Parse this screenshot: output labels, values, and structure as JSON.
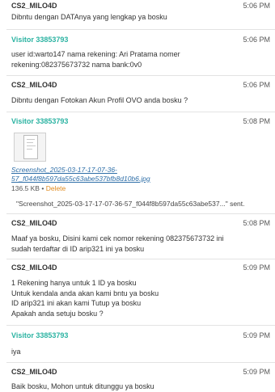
{
  "messages": [
    {
      "sender": "CS2_MILO4D",
      "time": "5:06 PM",
      "lines": [
        "Dibntu dengan DATAnya yang lengkap ya bosku"
      ]
    },
    {
      "sender": "Visitor 33853793",
      "time": "5:06 PM",
      "lines": [
        "user id:warto147 nama rekening: Ari Pratama nomer",
        "rekening:082375673732 nama bank:0v0"
      ]
    },
    {
      "sender": "CS2_MILO4D",
      "time": "5:06 PM",
      "lines": [
        "Dibntu dengan Fotokan Akun Profil OVO anda bosku ?"
      ]
    },
    {
      "sender": "Visitor 33853793",
      "time": "5:08 PM",
      "attachment": {
        "name_line1": "Screenshot_2025-03-17-17-07-36-",
        "name_line2": "57_f044f8b597da55c63abe537bfb8d10b6.jpg",
        "size": "136.5 KB",
        "delete_label": "Delete",
        "sent_note": "\"Screenshot_2025-03-17-17-07-36-57_f044f8b597da55c63abe537...\" sent."
      }
    },
    {
      "sender": "CS2_MILO4D",
      "time": "5:08 PM",
      "lines": [
        "Maaf ya bosku, Disini kami cek nomor rekening 082375673732 ini",
        "sudah terdaftar di ID arip321 ini ya bosku"
      ]
    },
    {
      "sender": "CS2_MILO4D",
      "time": "5:09 PM",
      "lines": [
        "1 Rekening hanya untuk 1 ID ya bosku",
        "Untuk kendala anda akan kami bntu ya bosku",
        "ID arip321 ini akan kami Tutup ya bosku",
        "Apakah anda setuju bosku ?"
      ]
    },
    {
      "sender": "Visitor 33853793",
      "time": "5:09 PM",
      "lines": [
        "iya"
      ]
    },
    {
      "sender": "CS2_MILO4D",
      "time": "5:09 PM",
      "lines": [
        "Baik bosku, Mohon untuk ditunggu ya bosku"
      ]
    }
  ],
  "colors": {
    "agent_name": "#333333",
    "visitor_name": "#2bb3a2",
    "link": "#2f6fa8",
    "delete": "#e08a1e",
    "separator": "#e3e3e3"
  },
  "icons": {
    "attachment_thumbnail": "image-thumbnail"
  }
}
